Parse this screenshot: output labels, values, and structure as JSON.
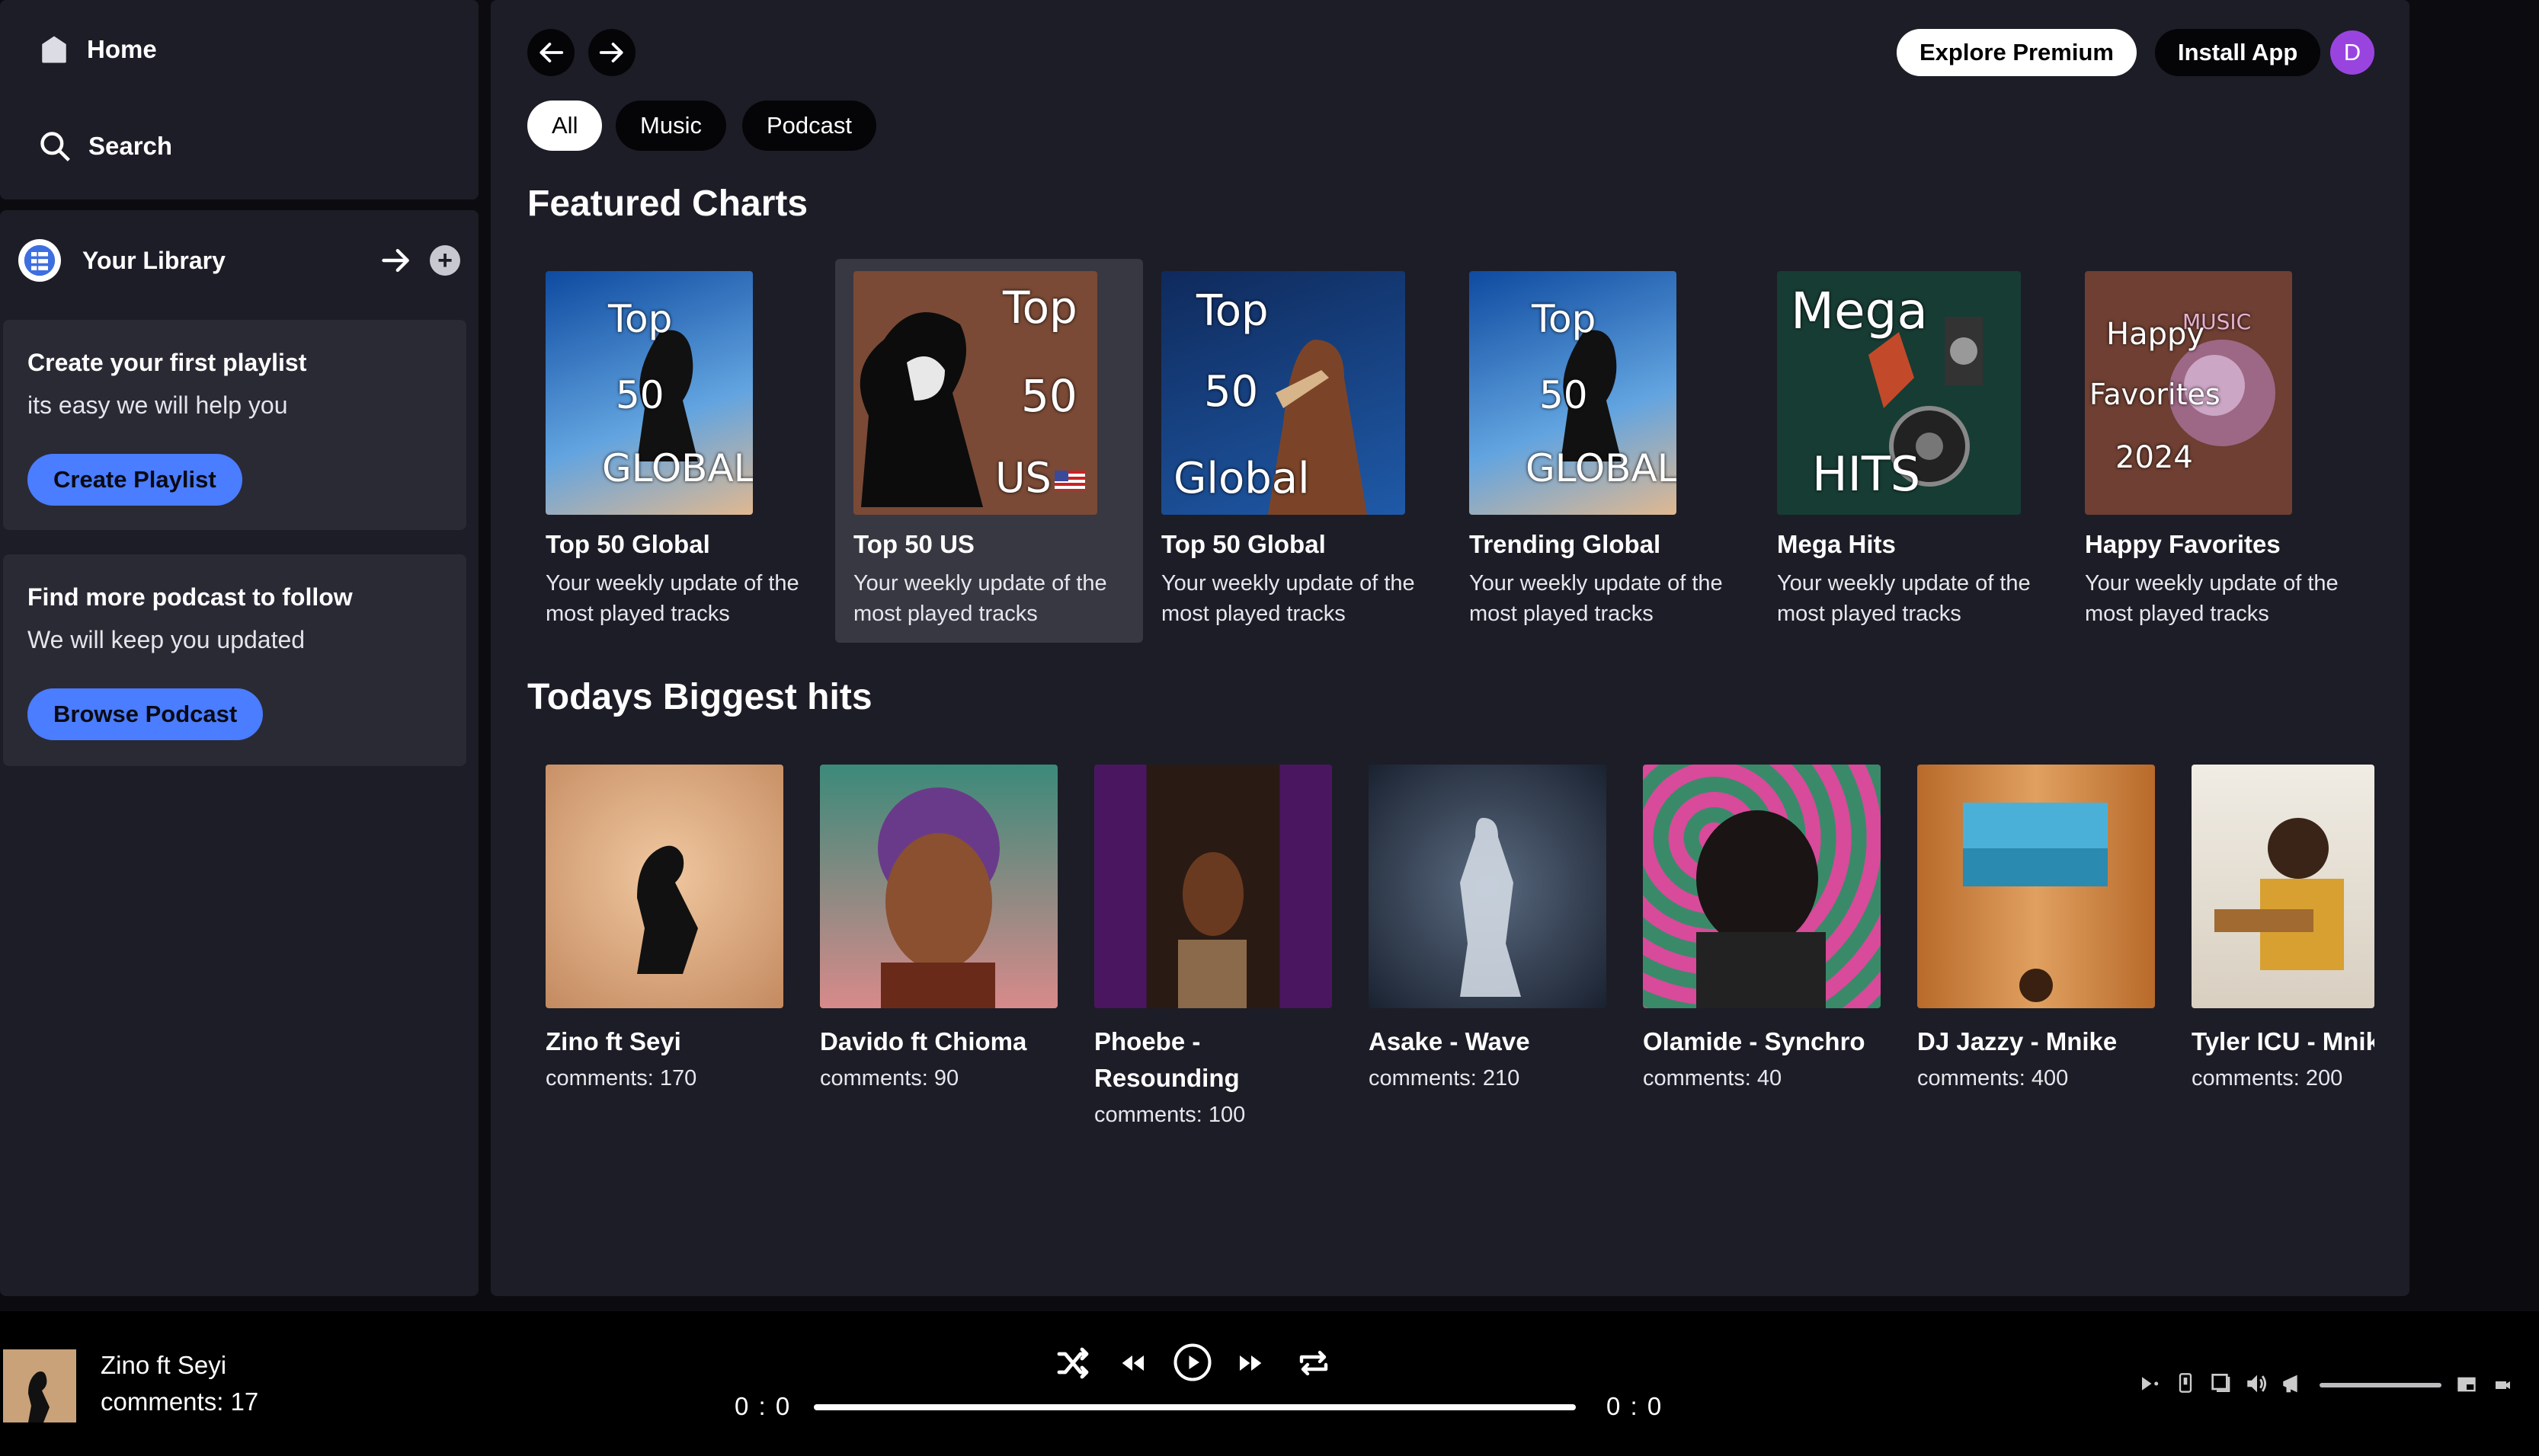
{
  "sidebar": {
    "home_label": "Home",
    "search_label": "Search",
    "library_label": "Your Library",
    "playlist_card": {
      "title": "Create your first playlist",
      "subtitle": "its easy we will help you",
      "button": "Create Playlist"
    },
    "podcast_card": {
      "title": "Find more podcast to follow",
      "subtitle": "We will keep you updated",
      "button": "Browse Podcast"
    }
  },
  "topbar": {
    "explore_premium": "Explore Premium",
    "install_app": "Install App",
    "avatar_letter": "D"
  },
  "filters": [
    "All",
    "Music",
    "Podcast"
  ],
  "featured": {
    "title": "Featured Charts",
    "items": [
      {
        "name": "Top 50 Global",
        "desc": "Your weekly update of the most played tracks",
        "art": [
          "Top",
          "50",
          "GLOBAL"
        ]
      },
      {
        "name": "Top 50 US",
        "desc": "Your weekly update of the most played tracks",
        "art": [
          "Top",
          "50",
          "US"
        ]
      },
      {
        "name": "Top 50 Global",
        "desc": "Your weekly update of the most played tracks",
        "art": [
          "Top",
          "50",
          "Global"
        ]
      },
      {
        "name": "Trending Global",
        "desc": "Your weekly update of the most played tracks",
        "art": [
          "Top",
          "50",
          "GLOBAL"
        ]
      },
      {
        "name": "Mega Hits",
        "desc": "Your weekly update of the most played tracks",
        "art": [
          "Mega",
          "HITS"
        ]
      },
      {
        "name": "Happy Favorites",
        "desc": "Your weekly update of the most played tracks",
        "art": [
          "Happy",
          "Favorites",
          "2024",
          "MUSIC"
        ]
      }
    ]
  },
  "hits": {
    "title": "Todays Biggest hits",
    "items": [
      {
        "name": "Zino ft Seyi",
        "sub": "comments: 170"
      },
      {
        "name": "Davido ft Chioma",
        "sub": "comments: 90"
      },
      {
        "name": "Phoebe - Resounding",
        "sub": "comments: 100"
      },
      {
        "name": "Asake - Wave",
        "sub": "comments: 210"
      },
      {
        "name": "Olamide - Synchro",
        "sub": "comments: 40"
      },
      {
        "name": "DJ Jazzy - Mnike",
        "sub": "comments: 400"
      },
      {
        "name": "Tyler ICU - Mnike",
        "sub": "comments: 200"
      }
    ]
  },
  "player": {
    "title": "Zino ft Seyi",
    "subtitle": "comments: 17",
    "time_current": "0 : 0",
    "time_total": "0 : 0",
    "progress": 0
  },
  "colors": {
    "accent": "#4a7dff",
    "panel": "#1d1d27",
    "background": "#0b0b10",
    "avatar": "#9a44e0"
  }
}
